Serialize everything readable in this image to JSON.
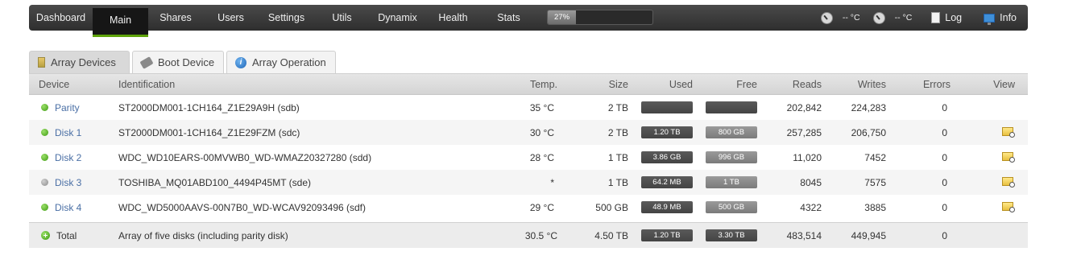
{
  "nav": {
    "items": [
      {
        "label": "Dashboard",
        "active": false
      },
      {
        "label": "Main",
        "active": true
      },
      {
        "label": "Shares",
        "active": false
      },
      {
        "label": "Users",
        "active": false
      },
      {
        "label": "Settings",
        "active": false
      },
      {
        "label": "Utils",
        "active": false
      },
      {
        "label": "Dynamix",
        "active": false
      },
      {
        "label": "Health",
        "active": false
      },
      {
        "label": "Stats",
        "active": false
      }
    ],
    "progress_label": "27%",
    "progress_fraction": 0.27,
    "temp1": "-- °C",
    "temp2": "-- °C",
    "log_label": "Log",
    "info_label": "Info"
  },
  "tabs": [
    {
      "label": "Array Devices",
      "icon": "array-devices-icon",
      "active": true
    },
    {
      "label": "Boot Device",
      "icon": "usb-icon",
      "active": false
    },
    {
      "label": "Array Operation",
      "icon": "info-icon",
      "active": false
    }
  ],
  "table": {
    "headers": {
      "device": "Device",
      "identification": "Identification",
      "temp": "Temp.",
      "size": "Size",
      "used": "Used",
      "free": "Free",
      "reads": "Reads",
      "writes": "Writes",
      "errors": "Errors",
      "view": "View"
    },
    "rows": [
      {
        "device": "Parity",
        "status": "green",
        "identification": "ST2000DM001-1CH164_Z1E29A9H (sdb)",
        "temp": "35 °C",
        "size": "2 TB",
        "used": "",
        "free": "",
        "reads": "202,842",
        "writes": "224,283",
        "errors": "0",
        "view": false
      },
      {
        "device": "Disk 1",
        "status": "green",
        "identification": "ST2000DM001-1CH164_Z1E29FZM (sdc)",
        "temp": "30 °C",
        "size": "2 TB",
        "used": "1.20 TB",
        "free": "800 GB",
        "reads": "257,285",
        "writes": "206,750",
        "errors": "0",
        "view": true
      },
      {
        "device": "Disk 2",
        "status": "green",
        "identification": "WDC_WD10EARS-00MVWB0_WD-WMAZ20327280 (sdd)",
        "temp": "28 °C",
        "size": "1 TB",
        "used": "3.86 GB",
        "free": "996 GB",
        "reads": "11,020",
        "writes": "7452",
        "errors": "0",
        "view": true
      },
      {
        "device": "Disk 3",
        "status": "grey",
        "identification": "TOSHIBA_MQ01ABD100_4494P45MT (sde)",
        "temp": "*",
        "size": "1 TB",
        "used": "64.2 MB",
        "free": "1 TB",
        "reads": "8045",
        "writes": "7575",
        "errors": "0",
        "view": true
      },
      {
        "device": "Disk 4",
        "status": "green",
        "identification": "WDC_WD5000AAVS-00N7B0_WD-WCAV92093496 (sdf)",
        "temp": "29 °C",
        "size": "500 GB",
        "used": "48.9 MB",
        "free": "500 GB",
        "reads": "4322",
        "writes": "3885",
        "errors": "0",
        "view": true
      }
    ],
    "total": {
      "device": "Total",
      "identification": "Array of five disks (including parity disk)",
      "temp": "30.5 °C",
      "size": "4.50 TB",
      "used": "1.20 TB",
      "free": "3.30 TB",
      "reads": "483,514",
      "writes": "449,945",
      "errors": "0"
    }
  }
}
